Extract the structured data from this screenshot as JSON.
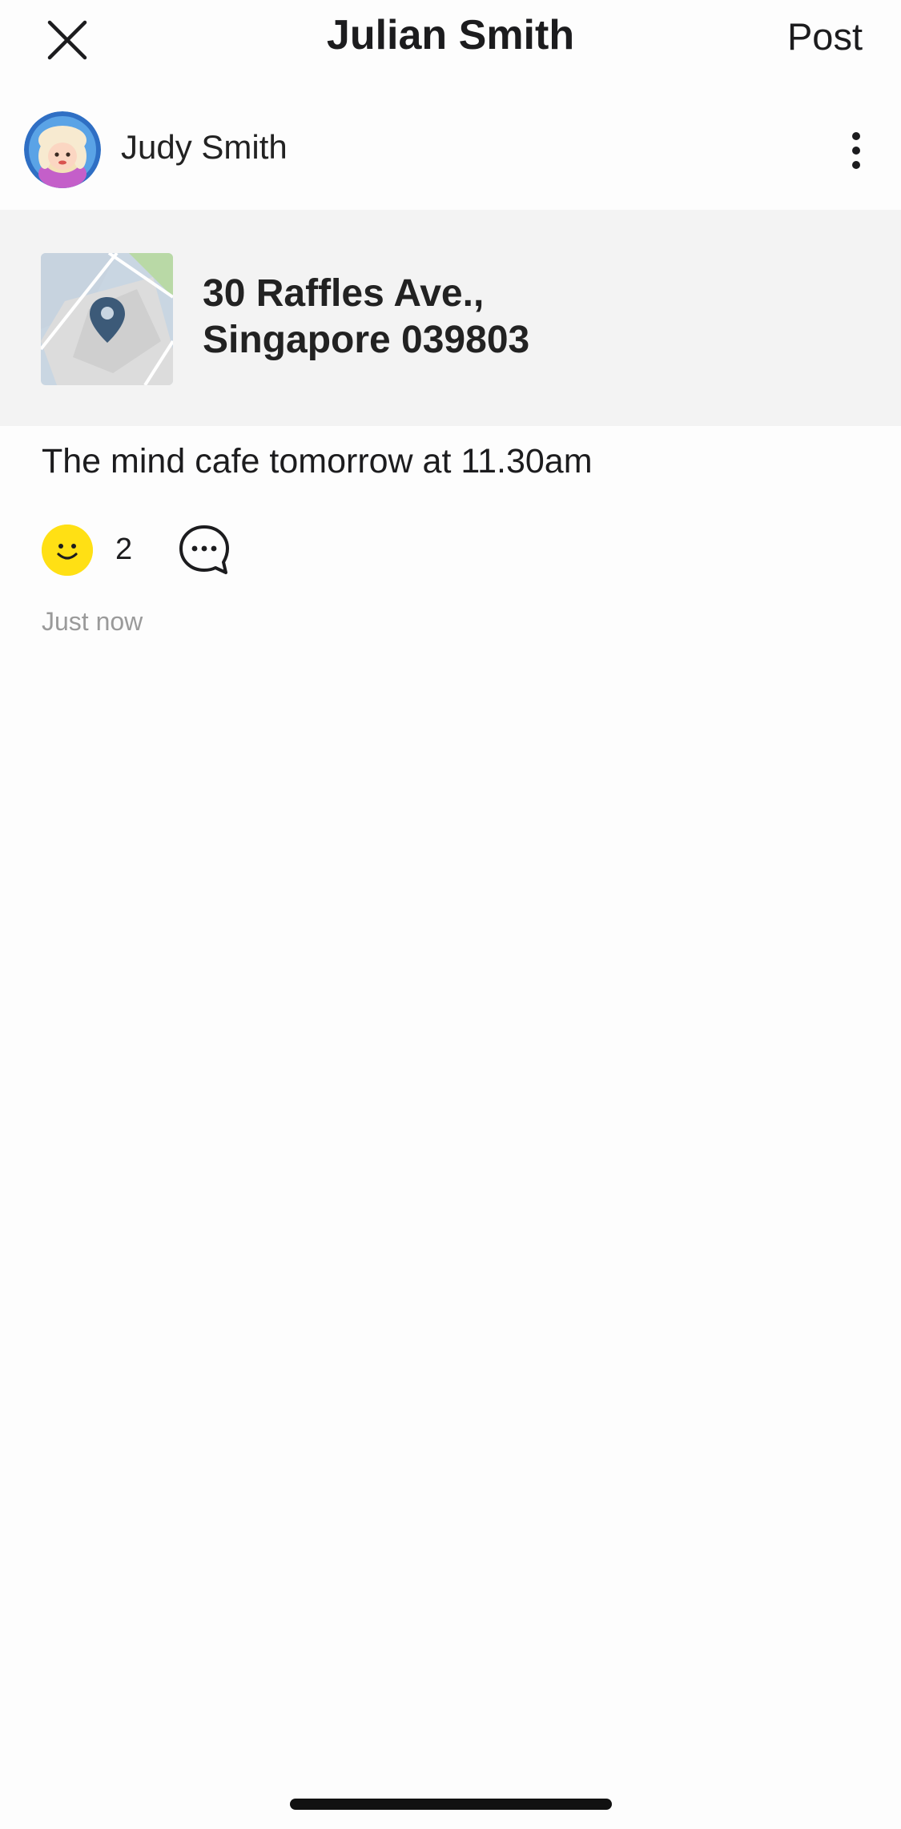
{
  "header": {
    "title": "Julian Smith",
    "post_label": "Post",
    "close_icon": "close-icon"
  },
  "author": {
    "name": "Judy Smith",
    "more_icon": "vertical-ellipsis-icon"
  },
  "location": {
    "address_line1": "30 Raffles Ave.,",
    "address_line2": "Singapore 039803",
    "map_icon": "map-pin-icon"
  },
  "post": {
    "text": "The mind cafe tomorrow at 11.30am",
    "reaction_count": "2",
    "reaction_icon": "smiley-icon",
    "comment_icon": "comment-bubble-icon",
    "timestamp": "Just now"
  },
  "colors": {
    "reaction_yellow": "#ffe014",
    "card_background": "#f3f3f3",
    "timestamp_gray": "#9a9a9a"
  }
}
